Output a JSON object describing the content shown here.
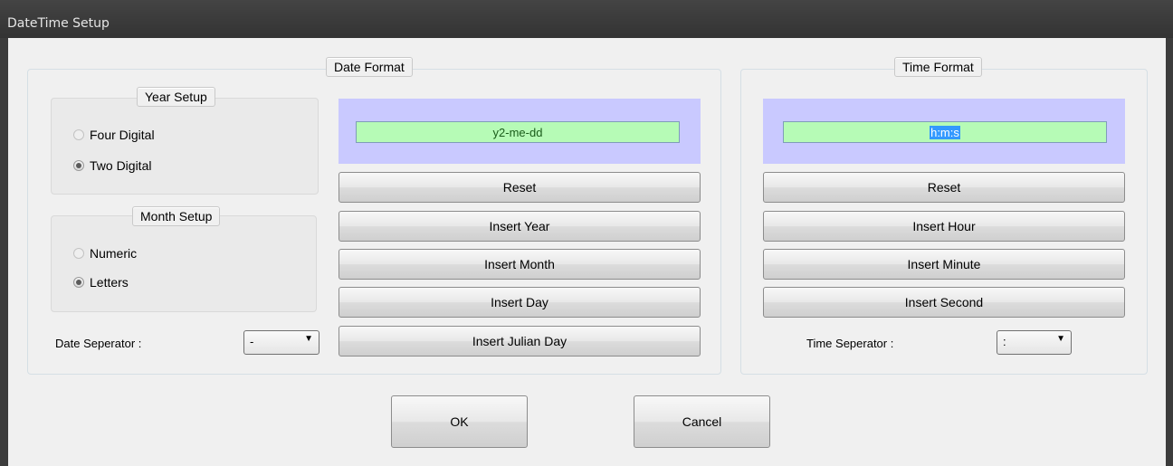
{
  "window": {
    "title": "DateTime Setup"
  },
  "date_format": {
    "legend": "Date Format",
    "year_setup": {
      "legend": "Year Setup",
      "options": [
        {
          "label": "Four Digital",
          "checked": false
        },
        {
          "label": "Two Digital",
          "checked": true
        }
      ]
    },
    "month_setup": {
      "legend": "Month Setup",
      "options": [
        {
          "label": "Numeric",
          "checked": false
        },
        {
          "label": "Letters",
          "checked": true
        }
      ]
    },
    "format_value": "y2-me-dd",
    "buttons": {
      "reset": "Reset",
      "insert_year": "Insert Year",
      "insert_month": "Insert Month",
      "insert_day": "Insert Day",
      "insert_julian_day": "Insert Julian Day"
    },
    "separator_label": "Date Seperator :",
    "separator_value": "-"
  },
  "time_format": {
    "legend": "Time Format",
    "format_value": "h:m:s",
    "buttons": {
      "reset": "Reset",
      "insert_hour": "Insert Hour",
      "insert_minute": "Insert Minute",
      "insert_second": "Insert Second"
    },
    "separator_label": "Time Seperator :",
    "separator_value": ":"
  },
  "footer": {
    "ok": "OK",
    "cancel": "Cancel"
  },
  "colors": {
    "titlebar": "#3c3c3c",
    "client": "#f0f0f0",
    "preview_bg": "#c9c9ff",
    "format_field_bg": "#b6fbb6",
    "selection": "#3399ff"
  },
  "icons": {
    "dropdown": "chevron-down-icon"
  }
}
